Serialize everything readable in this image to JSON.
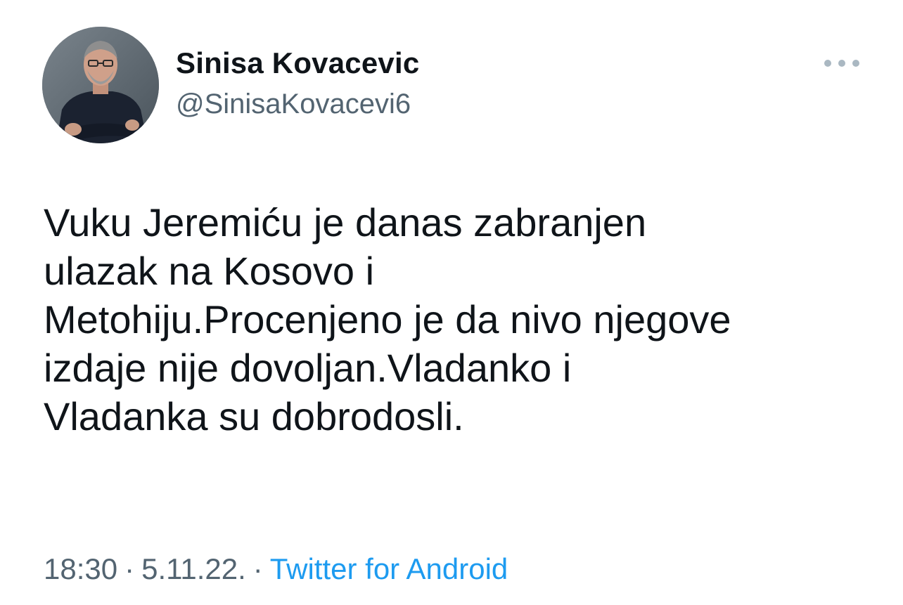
{
  "tweet": {
    "author_name": "Sinisa Kovacevic",
    "author_handle": "@SinisaKovacevi6",
    "text": "Vuku Jeremiću je danas zabranjen\nulazak na Kosovo i\nMetohiju.Procenjeno je da nivo njegove\nizdaje nije dovoljan.Vladanko i\nVladanka su dobrodosli.",
    "time": "18:30",
    "date": "5.11.22.",
    "source": "Twitter for Android",
    "separator": "·"
  },
  "icons": {
    "more": "more-options-icon"
  },
  "colors": {
    "text": "#0f1419",
    "secondary": "#536471",
    "link": "#1d9bf0",
    "background": "#ffffff"
  }
}
